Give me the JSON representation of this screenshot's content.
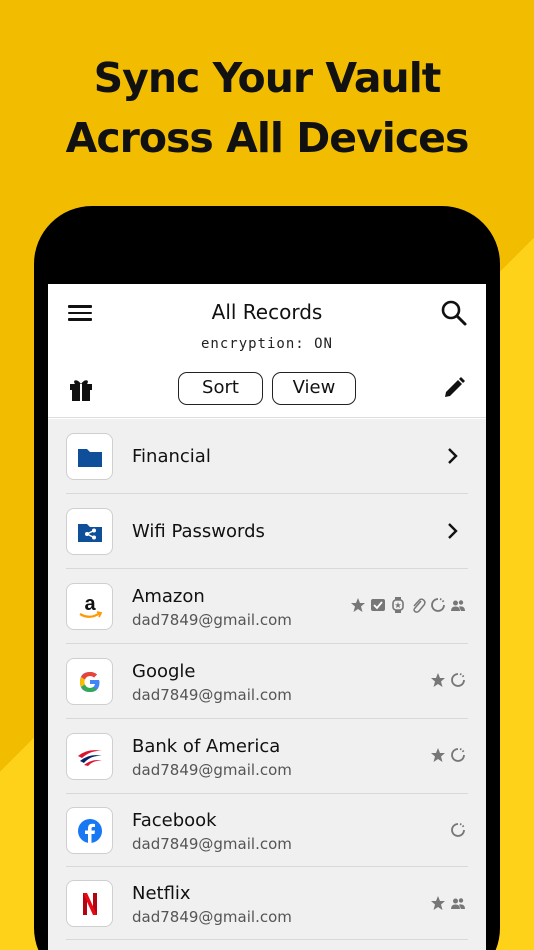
{
  "promo": {
    "headline_line1": "Sync Your Vault",
    "headline_line2": "Across All Devices"
  },
  "colors": {
    "background": "#f5c400",
    "folder_blue": "#0f4f9a"
  },
  "app": {
    "title": "All Records",
    "encryption_status": "encryption: ON",
    "sort_label": "Sort",
    "view_label": "View",
    "icons": [
      "menu-icon",
      "search-icon",
      "gift-icon",
      "edit-icon"
    ]
  },
  "folders": [
    {
      "name": "Financial",
      "icon": "folder-icon"
    },
    {
      "name": "Wifi Passwords",
      "icon": "shared-folder-icon"
    }
  ],
  "records": [
    {
      "name": "Amazon",
      "email": "dad7849@gmail.com",
      "icon": "amazon-logo-icon",
      "badges": [
        "star-icon",
        "check-icon",
        "watch-icon",
        "attachment-icon",
        "sync-icon",
        "shared-users-icon"
      ]
    },
    {
      "name": "Google",
      "email": "dad7849@gmail.com",
      "icon": "google-logo-icon",
      "badges": [
        "star-icon",
        "sync-icon"
      ]
    },
    {
      "name": "Bank of America",
      "email": "dad7849@gmail.com",
      "icon": "bank-of-america-logo-icon",
      "badges": [
        "star-icon",
        "sync-icon"
      ]
    },
    {
      "name": "Facebook",
      "email": "dad7849@gmail.com",
      "icon": "facebook-logo-icon",
      "badges": [
        "sync-icon"
      ]
    },
    {
      "name": "Netflix",
      "email": "dad7849@gmail.com",
      "icon": "netflix-logo-icon",
      "badges": [
        "star-icon",
        "shared-users-icon"
      ]
    }
  ]
}
